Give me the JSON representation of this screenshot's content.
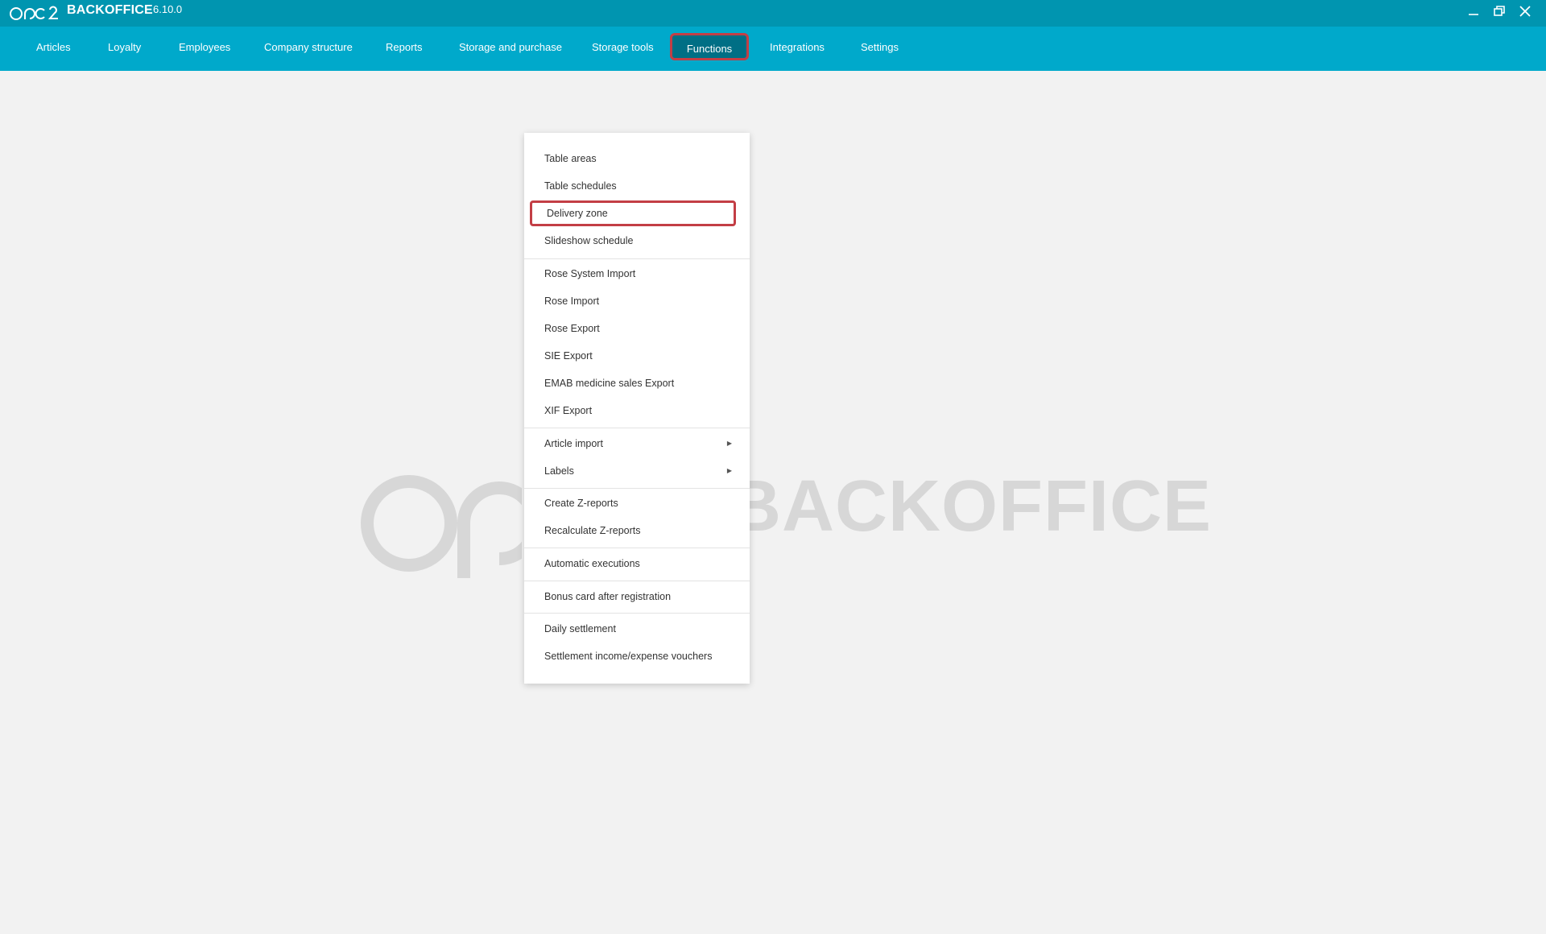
{
  "app": {
    "title": "BACKOFFICE",
    "version": "6.10.0"
  },
  "nav": {
    "items": [
      {
        "label": "Articles"
      },
      {
        "label": "Loyalty"
      },
      {
        "label": "Employees"
      },
      {
        "label": "Company structure"
      },
      {
        "label": "Reports"
      },
      {
        "label": "Storage and purchase"
      },
      {
        "label": "Storage tools"
      },
      {
        "label": "Functions",
        "active": true
      },
      {
        "label": "Integrations"
      },
      {
        "label": "Settings"
      }
    ]
  },
  "menu": {
    "items": [
      {
        "label": "Table areas"
      },
      {
        "label": "Table schedules"
      },
      {
        "label": "Delivery zone",
        "highlighted": true
      },
      {
        "label": "Slideshow schedule"
      },
      {
        "label": "Rose System Import"
      },
      {
        "label": "Rose Import"
      },
      {
        "label": "Rose Export"
      },
      {
        "label": "SIE Export"
      },
      {
        "label": "EMAB medicine sales Export"
      },
      {
        "label": "XIF Export"
      },
      {
        "label": "Article import",
        "submenu": true
      },
      {
        "label": "Labels",
        "submenu": true
      },
      {
        "label": "Create Z-reports"
      },
      {
        "label": "Recalculate Z-reports"
      },
      {
        "label": "Automatic executions"
      },
      {
        "label": "Bonus card after registration"
      },
      {
        "label": "Daily settlement"
      },
      {
        "label": "Settlement income/expense vouchers"
      }
    ]
  },
  "watermark": {
    "text": "BACKOFFICE"
  },
  "colors": {
    "titlebar": "#0095b0",
    "navbar": "#00a9cb",
    "active": "#006f85",
    "highlight": "#c33e45"
  },
  "icons": {
    "minimize": "minimize-icon",
    "restore": "restore-icon",
    "close": "close-icon",
    "submenu": "chevron-right-icon"
  }
}
